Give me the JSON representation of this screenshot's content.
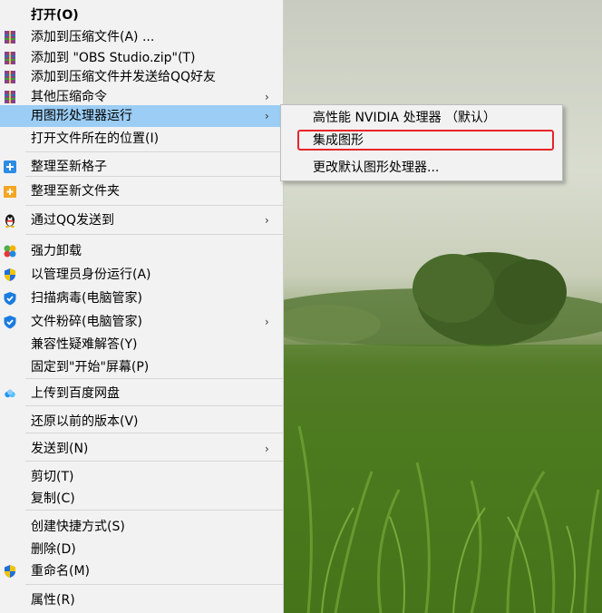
{
  "menu": {
    "items": [
      {
        "label": "打开(O)",
        "bold": true,
        "icon": "",
        "arrow": false,
        "highlight": false
      },
      {
        "label": "添加到压缩文件(A) ...",
        "icon": "archive-icon",
        "arrow": false,
        "highlight": false
      },
      {
        "label": "添加到 \"OBS Studio.zip\"(T)",
        "icon": "archive-icon",
        "arrow": false,
        "highlight": false
      },
      {
        "label": "添加到压缩文件并发送给QQ好友",
        "icon": "archive-icon",
        "arrow": false,
        "highlight": false
      },
      {
        "label": "其他压缩命令",
        "icon": "archive-icon",
        "arrow": true,
        "highlight": false
      },
      {
        "label": "用图形处理器运行",
        "icon": "",
        "arrow": true,
        "highlight": true
      },
      {
        "label": "打开文件所在的位置(I)",
        "icon": "",
        "arrow": false,
        "highlight": false
      },
      {
        "label": "整理至新格子",
        "icon": "blue-plus-icon",
        "arrow": false,
        "highlight": false
      },
      {
        "label": "整理至新文件夹",
        "icon": "orange-folder-plus-icon",
        "arrow": false,
        "highlight": false
      },
      {
        "label": "通过QQ发送到",
        "icon": "qq-penguin-icon",
        "arrow": true,
        "highlight": false
      },
      {
        "label": "强力卸载",
        "icon": "clover-icon",
        "arrow": false,
        "highlight": false
      },
      {
        "label": "以管理员身份运行(A)",
        "icon": "uac-shield-icon",
        "arrow": false,
        "highlight": false
      },
      {
        "label": "扫描病毒(电脑管家)",
        "icon": "tencent-shield-icon",
        "arrow": false,
        "highlight": false
      },
      {
        "label": "文件粉碎(电脑管家)",
        "icon": "tencent-shield-icon",
        "arrow": true,
        "highlight": false
      },
      {
        "label": "兼容性疑难解答(Y)",
        "icon": "",
        "arrow": false,
        "highlight": false
      },
      {
        "label": "固定到\"开始\"屏幕(P)",
        "icon": "",
        "arrow": false,
        "highlight": false
      },
      {
        "label": "上传到百度网盘",
        "icon": "baidu-cloud-icon",
        "arrow": false,
        "highlight": false
      },
      {
        "label": "还原以前的版本(V)",
        "icon": "",
        "arrow": false,
        "highlight": false
      },
      {
        "label": "发送到(N)",
        "icon": "",
        "arrow": true,
        "highlight": false
      },
      {
        "label": "剪切(T)",
        "icon": "",
        "arrow": false,
        "highlight": false
      },
      {
        "label": "复制(C)",
        "icon": "",
        "arrow": false,
        "highlight": false
      },
      {
        "label": "创建快捷方式(S)",
        "icon": "",
        "arrow": false,
        "highlight": false
      },
      {
        "label": "删除(D)",
        "icon": "",
        "arrow": false,
        "highlight": false
      },
      {
        "label": "重命名(M)",
        "icon": "uac-shield-icon",
        "arrow": false,
        "highlight": false
      },
      {
        "label": "属性(R)",
        "icon": "",
        "arrow": false,
        "highlight": false
      }
    ],
    "submenu_arrow": "›"
  },
  "submenu": {
    "items": [
      {
        "label": "高性能 NVIDIA 处理器 （默认）"
      },
      {
        "label": "集成图形",
        "annotated": true
      },
      {
        "label": "更改默认图形处理器..."
      }
    ],
    "annotation_color": "#e8242b"
  },
  "colors": {
    "menu_bg": "#f2f2f2",
    "highlight_bg": "#9bcdf5",
    "separator": "#d6d6d6"
  }
}
